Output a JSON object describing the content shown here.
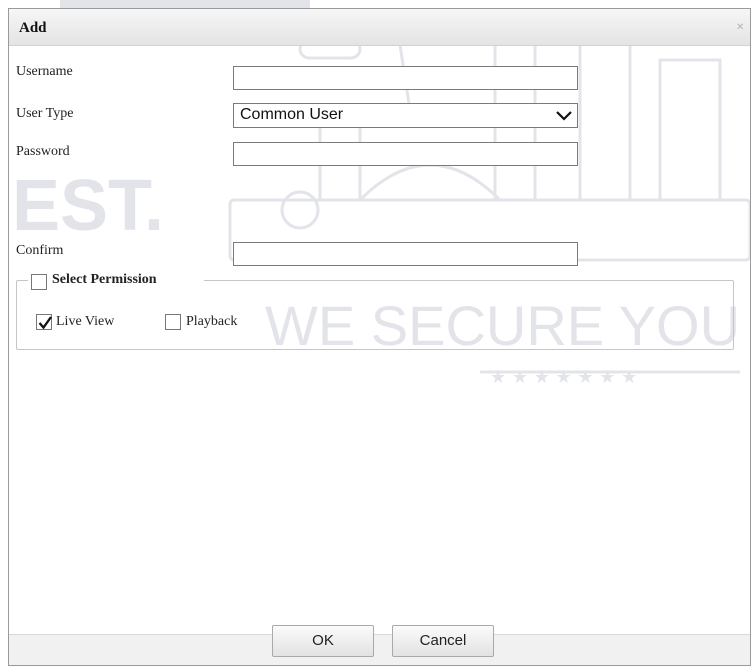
{
  "dialog": {
    "title": "Add"
  },
  "form": {
    "username_label": "Username",
    "username_value": "",
    "user_type_label": "User Type",
    "user_type_value": "Common User",
    "password_label": "Password",
    "password_value": "",
    "confirm_label": "Confirm",
    "confirm_value": ""
  },
  "permissions": {
    "title": "Select Permission",
    "select_all_checked": false,
    "options": [
      {
        "label": "Live View",
        "checked": true
      },
      {
        "label": "Playback",
        "checked": false
      }
    ]
  },
  "buttons": {
    "ok": "OK",
    "cancel": "Cancel"
  },
  "watermark": {
    "line1": "EST.",
    "line2": "WE SECURE YOU",
    "stars": "★ ★ ★ ★ ★ ★ ★"
  },
  "colors": {
    "watermark": "#d9dbe3",
    "border": "#7a7a7a"
  },
  "icons": {
    "close": "close-icon",
    "dropdown": "chevron-down-icon",
    "check": "checkmark-icon"
  }
}
